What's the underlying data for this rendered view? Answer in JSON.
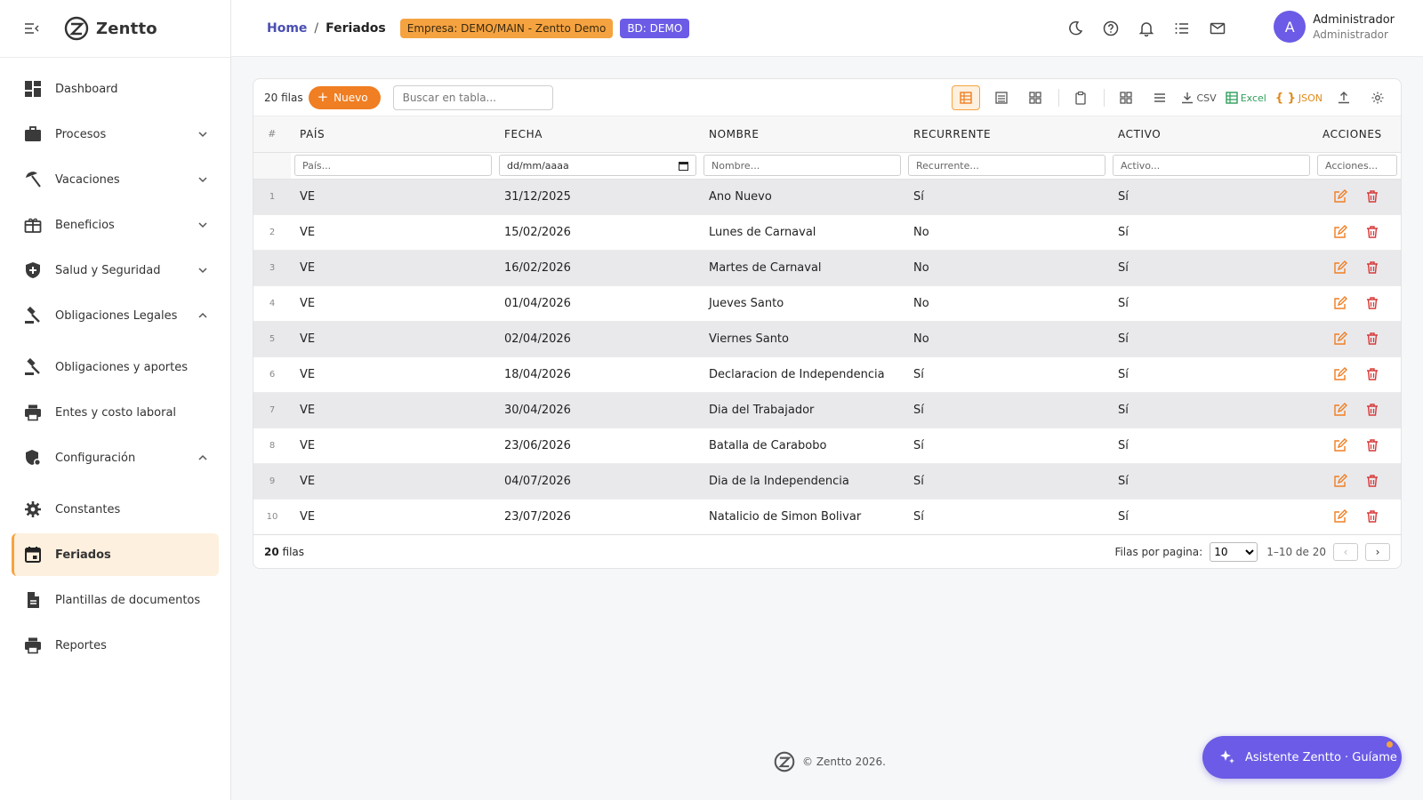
{
  "brand": {
    "name": "Zentto"
  },
  "sidebar": {
    "items": [
      {
        "label": "Dashboard",
        "icon": "dashboard-icon"
      },
      {
        "label": "Procesos",
        "icon": "briefcase-icon",
        "chevron": "down"
      },
      {
        "label": "Vacaciones",
        "icon": "beach-umbrella-icon",
        "chevron": "down"
      },
      {
        "label": "Beneficios",
        "icon": "gift-box-icon",
        "chevron": "down"
      },
      {
        "label": "Salud y Seguridad",
        "icon": "shield-icon",
        "chevron": "down"
      },
      {
        "label": "Obligaciones Legales",
        "icon": "gavel-icon",
        "chevron": "up"
      },
      {
        "label": "Obligaciones y aportes",
        "icon": "gavel-icon"
      },
      {
        "label": "Entes y costo laboral",
        "icon": "printer-icon"
      },
      {
        "label": "Configuración",
        "icon": "shield-gear-icon",
        "chevron": "up"
      },
      {
        "label": "Constantes",
        "icon": "gear-icon"
      },
      {
        "label": "Feriados",
        "icon": "calendar-icon",
        "active": true
      },
      {
        "label": "Plantillas de documentos",
        "icon": "document-icon"
      },
      {
        "label": "Reportes",
        "icon": "printer-icon"
      }
    ]
  },
  "header": {
    "breadcrumb_home": "Home",
    "breadcrumb_sep": "/",
    "breadcrumb_current": "Feriados",
    "company_badge": "Empresa: DEMO/MAIN - Zentto Demo",
    "db_badge": "BD: DEMO",
    "user_initial": "A",
    "user_name": "Administrador",
    "user_role": "Administrador"
  },
  "toolbar": {
    "rows_count": "20 filas",
    "new_label": "Nuevo",
    "search_placeholder": "Buscar en tabla...",
    "csv_label": "CSV",
    "excel_label": "Excel",
    "json_label": "JSON"
  },
  "table": {
    "columns": {
      "num": "#",
      "pais": "PAÍS",
      "fecha": "FECHA",
      "nombre": "NOMBRE",
      "recurrente": "RECURRENTE",
      "activo": "ACTIVO",
      "acciones": "ACCIONES"
    },
    "filters": {
      "pais": "País...",
      "fecha": "dd/mm/aaaa",
      "nombre": "Nombre...",
      "recurrente": "Recurrente...",
      "activo": "Activo...",
      "acciones": "Acciones..."
    },
    "rows": [
      {
        "n": "1",
        "pais": "VE",
        "fecha": "31/12/2025",
        "nombre": "Ano Nuevo",
        "recurrente": "Sí",
        "activo": "Sí"
      },
      {
        "n": "2",
        "pais": "VE",
        "fecha": "15/02/2026",
        "nombre": "Lunes de Carnaval",
        "recurrente": "No",
        "activo": "Sí"
      },
      {
        "n": "3",
        "pais": "VE",
        "fecha": "16/02/2026",
        "nombre": "Martes de Carnaval",
        "recurrente": "No",
        "activo": "Sí"
      },
      {
        "n": "4",
        "pais": "VE",
        "fecha": "01/04/2026",
        "nombre": "Jueves Santo",
        "recurrente": "No",
        "activo": "Sí"
      },
      {
        "n": "5",
        "pais": "VE",
        "fecha": "02/04/2026",
        "nombre": "Viernes Santo",
        "recurrente": "No",
        "activo": "Sí"
      },
      {
        "n": "6",
        "pais": "VE",
        "fecha": "18/04/2026",
        "nombre": "Declaracion de Independencia",
        "recurrente": "Sí",
        "activo": "Sí"
      },
      {
        "n": "7",
        "pais": "VE",
        "fecha": "30/04/2026",
        "nombre": "Dia del Trabajador",
        "recurrente": "Sí",
        "activo": "Sí"
      },
      {
        "n": "8",
        "pais": "VE",
        "fecha": "23/06/2026",
        "nombre": "Batalla de Carabobo",
        "recurrente": "Sí",
        "activo": "Sí"
      },
      {
        "n": "9",
        "pais": "VE",
        "fecha": "04/07/2026",
        "nombre": "Dia de la Independencia",
        "recurrente": "Sí",
        "activo": "Sí"
      },
      {
        "n": "10",
        "pais": "VE",
        "fecha": "23/07/2026",
        "nombre": "Natalicio de Simon Bolivar",
        "recurrente": "Sí",
        "activo": "Sí"
      }
    ]
  },
  "footer": {
    "count_number": "20",
    "count_label": "filas",
    "rows_per_page_label": "Filas por pagina:",
    "rows_per_page_value": "10",
    "range": "1–10 de 20",
    "prev": "‹",
    "next": "›"
  },
  "copyright": "© Zentto 2026.",
  "assistant_label": "Asistente Zentto · Guíame",
  "colors": {
    "accent": "#f07e22",
    "brand": "#6b5be6",
    "active_bg": "#fdf0de"
  }
}
